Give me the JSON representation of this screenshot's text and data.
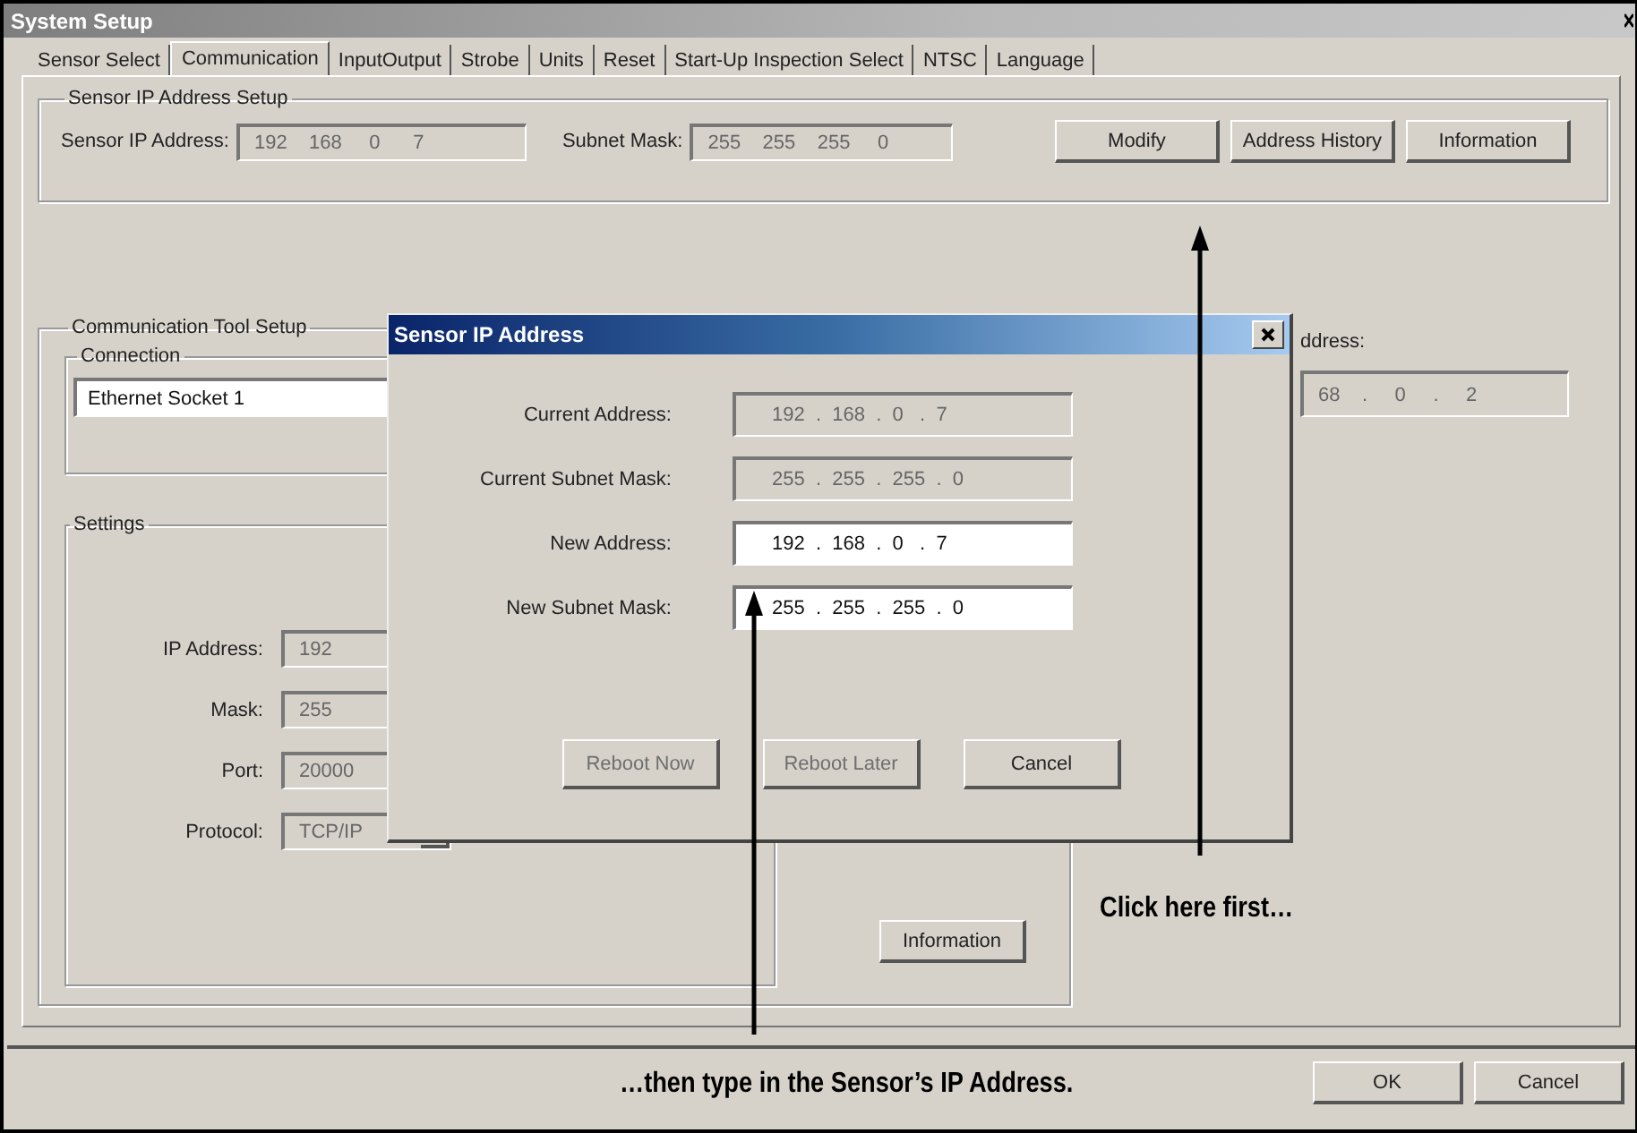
{
  "window": {
    "title": "System Setup"
  },
  "tabs": [
    {
      "label": "Sensor Select",
      "selected": false
    },
    {
      "label": "Communication",
      "selected": true
    },
    {
      "label": "InputOutput",
      "selected": false
    },
    {
      "label": "Strobe",
      "selected": false
    },
    {
      "label": "Units",
      "selected": false
    },
    {
      "label": "Reset",
      "selected": false
    },
    {
      "label": "Start-Up Inspection Select",
      "selected": false
    },
    {
      "label": "NTSC",
      "selected": false
    },
    {
      "label": "Language",
      "selected": false
    }
  ],
  "ip_setup": {
    "title": "Sensor IP Address Setup",
    "ip_label": "Sensor IP Address:",
    "ip_value": "192    168     0      7",
    "mask_label": "Subnet Mask:",
    "mask_value": "255    255    255     0",
    "buttons": [
      "Modify",
      "Address History",
      "Information"
    ]
  },
  "comm_setup": {
    "title": "Communication Tool Setup",
    "connection": {
      "title": "Connection",
      "value": "Ethernet Socket 1"
    },
    "settings": {
      "title": "Settings",
      "rows": [
        {
          "label": "IP Address:",
          "value": "192",
          "kind": "text"
        },
        {
          "label": "Mask:",
          "value": "255",
          "kind": "text"
        },
        {
          "label": "Port:",
          "value": "20000",
          "kind": "text"
        },
        {
          "label": "Protocol:",
          "value": "TCP/IP",
          "kind": "combo"
        }
      ]
    },
    "information_button": "Information"
  },
  "side": {
    "label": "ddress:",
    "value": "68    .     0     .     2"
  },
  "footer_buttons": [
    "OK",
    "Cancel"
  ],
  "dialog": {
    "title": "Sensor IP Address",
    "rows": [
      {
        "label": "Current Address:",
        "value": "192  .  168  .  0   .  7",
        "disabled": true
      },
      {
        "label": "Current Subnet Mask:",
        "value": "255  .  255  .  255  .  0",
        "disabled": true
      },
      {
        "label": "New Address:",
        "value": "192  .  168  .  0   .  7",
        "disabled": false
      },
      {
        "label": "New Subnet Mask:",
        "value": "255  .  255  .  255  .  0",
        "disabled": false
      }
    ],
    "buttons": [
      {
        "label": "Reboot Now",
        "disabled": true
      },
      {
        "label": "Reboot Later",
        "disabled": true
      },
      {
        "label": "Cancel",
        "disabled": false
      }
    ]
  },
  "annotations": [
    {
      "text": "Click here first…"
    },
    {
      "text": "…then type in the Sensor’s IP Address."
    }
  ]
}
